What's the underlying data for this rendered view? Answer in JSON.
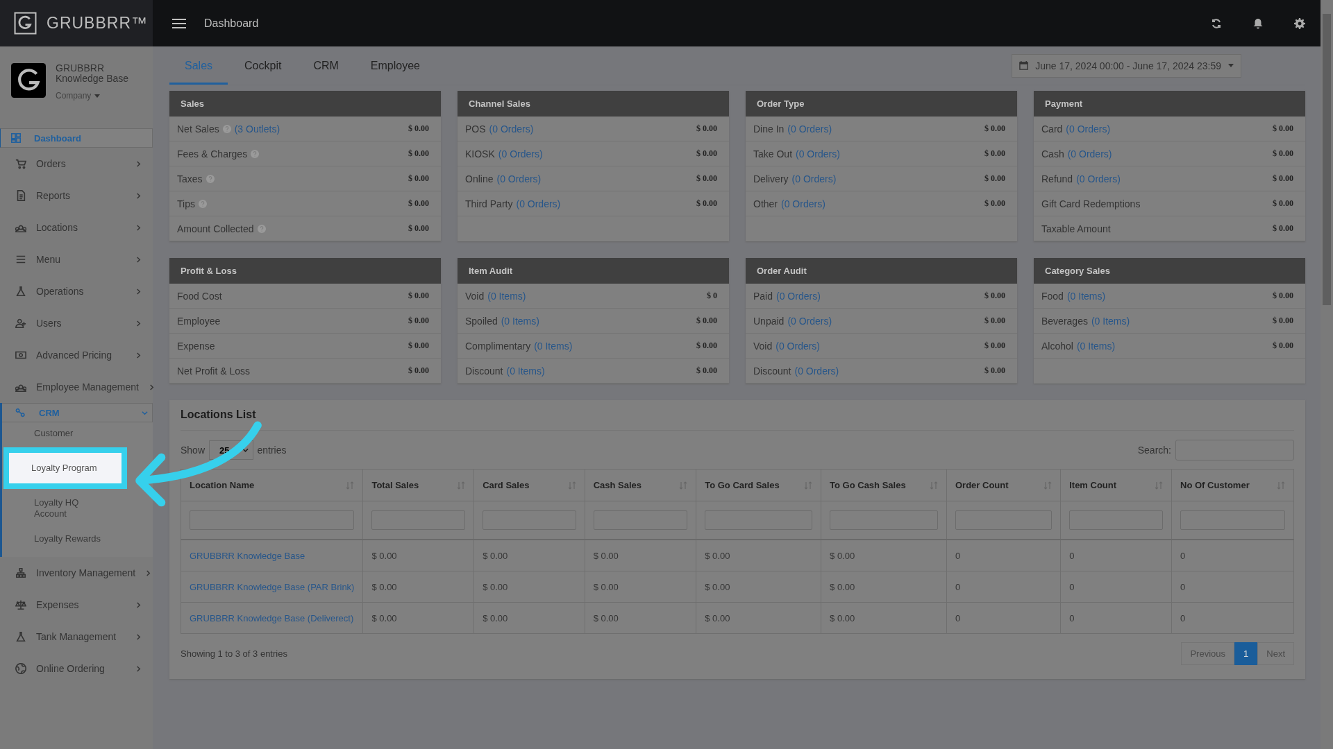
{
  "brand": {
    "name": "GRUBBRR™"
  },
  "topbar": {
    "title": "Dashboard"
  },
  "account": {
    "name": "GRUBBRR Knowledge Base",
    "role": "Company"
  },
  "sidebar": {
    "items": [
      {
        "label": "Dashboard",
        "kind": "link",
        "selected": true
      },
      {
        "label": "Orders",
        "kind": "group",
        "selected": false,
        "expanded": false
      },
      {
        "label": "Reports",
        "kind": "group",
        "selected": false,
        "expanded": false
      },
      {
        "label": "Locations",
        "kind": "group",
        "selected": false,
        "expanded": false
      },
      {
        "label": "Menu",
        "kind": "group",
        "selected": false,
        "expanded": false
      },
      {
        "label": "Operations",
        "kind": "group",
        "selected": false,
        "expanded": false
      },
      {
        "label": "Users",
        "kind": "group",
        "selected": false,
        "expanded": false
      },
      {
        "label": "Advanced Pricing",
        "kind": "group",
        "selected": false,
        "expanded": false
      },
      {
        "label": "Employee Management",
        "kind": "group",
        "selected": false,
        "expanded": false
      },
      {
        "label": "CRM",
        "kind": "group",
        "selected": true,
        "expanded": true,
        "children": [
          {
            "label": "Customer",
            "highlighted": false
          },
          {
            "label": "Loyalty Program",
            "highlighted": true
          },
          {
            "label": "Loyalty HQ Account",
            "highlighted": false
          },
          {
            "label": "Loyalty Rewards",
            "highlighted": false
          }
        ]
      },
      {
        "label": "Inventory Management",
        "kind": "group",
        "selected": false,
        "expanded": false
      },
      {
        "label": "Expenses",
        "kind": "group",
        "selected": false,
        "expanded": false
      },
      {
        "label": "Tank Management",
        "kind": "group",
        "selected": false,
        "expanded": false
      },
      {
        "label": "Online Ordering",
        "kind": "group",
        "selected": false,
        "expanded": false
      }
    ]
  },
  "tabs": [
    {
      "label": "Sales",
      "selected": true
    },
    {
      "label": "Cockpit",
      "selected": false
    },
    {
      "label": "CRM",
      "selected": false
    },
    {
      "label": "Employee",
      "selected": false
    }
  ],
  "date_range": {
    "value": "June 17, 2024 00:00 - June 17, 2024 23:59"
  },
  "cards": [
    {
      "title": "Sales",
      "rows": [
        {
          "label": "Net Sales",
          "help": true,
          "link": "(3 Outlets)",
          "value": "$ 0.00"
        },
        {
          "label": "Fees & Charges",
          "help": true,
          "value": "$ 0.00"
        },
        {
          "label": "Taxes",
          "help": true,
          "value": "$ 0.00"
        },
        {
          "label": "Tips",
          "help": true,
          "value": "$ 0.00"
        },
        {
          "label": "Amount Collected",
          "help": true,
          "value": "$ 0.00"
        }
      ]
    },
    {
      "title": "Channel Sales",
      "rows": [
        {
          "label": "POS",
          "link": "(0 Orders)",
          "value": "$ 0.00"
        },
        {
          "label": "KIOSK",
          "link": "(0 Orders)",
          "value": "$ 0.00"
        },
        {
          "label": "Online",
          "link": "(0 Orders)",
          "value": "$ 0.00"
        },
        {
          "label": "Third Party",
          "link": "(0 Orders)",
          "value": "$ 0.00"
        }
      ]
    },
    {
      "title": "Order Type",
      "rows": [
        {
          "label": "Dine In",
          "link": "(0 Orders)",
          "value": "$ 0.00"
        },
        {
          "label": "Take Out",
          "link": "(0 Orders)",
          "value": "$ 0.00"
        },
        {
          "label": "Delivery",
          "link": "(0 Orders)",
          "value": "$ 0.00"
        },
        {
          "label": "Other",
          "link": "(0 Orders)",
          "value": "$ 0.00"
        }
      ]
    },
    {
      "title": "Payment",
      "rows": [
        {
          "label": "Card",
          "link": "(0 Orders)",
          "value": "$ 0.00"
        },
        {
          "label": "Cash",
          "link": "(0 Orders)",
          "value": "$ 0.00"
        },
        {
          "label": "Refund",
          "link": "(0 Orders)",
          "value": "$ 0.00"
        },
        {
          "label": "Gift Card Redemptions",
          "value": "$ 0.00"
        },
        {
          "label": "Taxable Amount",
          "value": "$ 0.00"
        }
      ]
    },
    {
      "title": "Profit & Loss",
      "rows": [
        {
          "label": "Food Cost",
          "value": "$ 0.00"
        },
        {
          "label": "Employee",
          "value": "$ 0.00"
        },
        {
          "label": "Expense",
          "value": "$ 0.00"
        },
        {
          "label": "Net Profit & Loss",
          "value": "$ 0.00"
        }
      ]
    },
    {
      "title": "Item Audit",
      "rows": [
        {
          "label": "Void",
          "link": "(0 Items)",
          "value": "$ 0"
        },
        {
          "label": "Spoiled",
          "link": "(0 Items)",
          "value": "$ 0.00"
        },
        {
          "label": "Complimentary",
          "link": "(0 Items)",
          "value": "$ 0.00"
        },
        {
          "label": "Discount",
          "link": "(0 Items)",
          "value": "$ 0.00"
        }
      ]
    },
    {
      "title": "Order Audit",
      "rows": [
        {
          "label": "Paid",
          "link": "(0 Orders)",
          "value": "$ 0.00"
        },
        {
          "label": "Unpaid",
          "link": "(0 Orders)",
          "value": "$ 0.00"
        },
        {
          "label": "Void",
          "link": "(0 Orders)",
          "value": "$ 0.00"
        },
        {
          "label": "Discount",
          "link": "(0 Orders)",
          "value": "$ 0.00"
        }
      ]
    },
    {
      "title": "Category Sales",
      "rows": [
        {
          "label": "Food",
          "link": "(0 Items)",
          "value": "$ 0.00"
        },
        {
          "label": "Beverages",
          "link": "(0 Items)",
          "value": "$ 0.00"
        },
        {
          "label": "Alcohol",
          "link": "(0 Items)",
          "value": "$ 0.00"
        }
      ]
    }
  ],
  "locations": {
    "title": "Locations List",
    "show_label": "Show",
    "page_size": "25",
    "entries_label": "entries",
    "search_label": "Search:",
    "columns": [
      "Location Name",
      "Total Sales",
      "Card Sales",
      "Cash Sales",
      "To Go Card Sales",
      "To Go Cash Sales",
      "Order Count",
      "Item Count",
      "No Of Customer"
    ],
    "rows": [
      [
        "GRUBBRR Knowledge Base",
        "$ 0.00",
        "$ 0.00",
        "$ 0.00",
        "$ 0.00",
        "$ 0.00",
        "0",
        "0",
        "0"
      ],
      [
        "GRUBBRR Knowledge Base (PAR Brink)",
        "$ 0.00",
        "$ 0.00",
        "$ 0.00",
        "$ 0.00",
        "$ 0.00",
        "0",
        "0",
        "0"
      ],
      [
        "GRUBBRR Knowledge Base (Deliverect)",
        "$ 0.00",
        "$ 0.00",
        "$ 0.00",
        "$ 0.00",
        "$ 0.00",
        "0",
        "0",
        "0"
      ]
    ],
    "info": "Showing 1 to 3 of 3 entries",
    "pagination": [
      {
        "label": "Previous",
        "disabled": true,
        "selected": false
      },
      {
        "label": "1",
        "disabled": false,
        "selected": true
      },
      {
        "label": "Next",
        "disabled": true,
        "selected": false
      }
    ]
  }
}
